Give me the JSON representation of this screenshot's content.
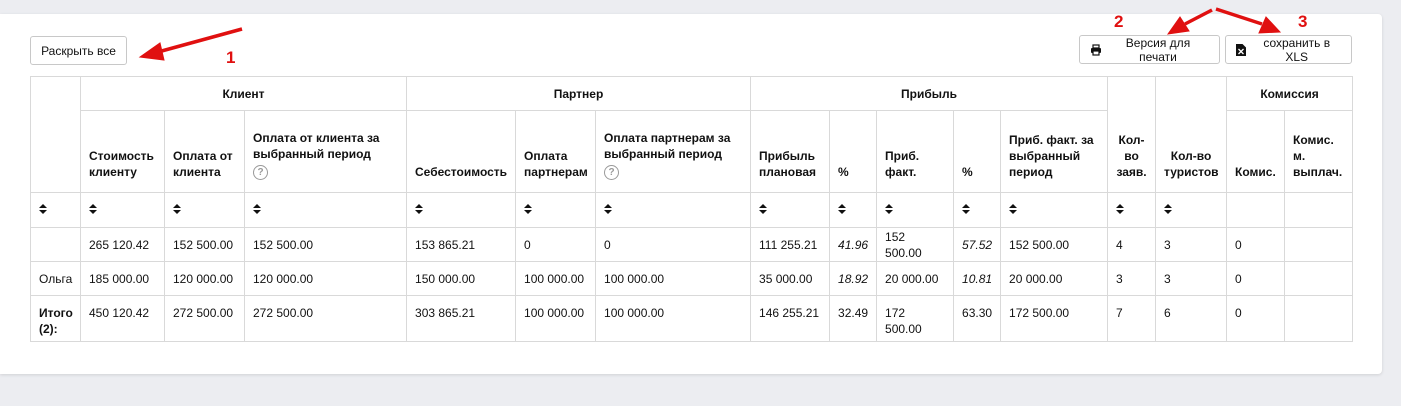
{
  "toolbar": {
    "expand_label": "Раскрыть все",
    "print_label": "Версия для печати",
    "xls_label": "сохранить в XLS"
  },
  "annotations": {
    "label_1": "1",
    "label_2": "2",
    "label_3": "3",
    "color": "#e01010"
  },
  "table": {
    "groups": {
      "client": "Клиент",
      "partner": "Партнер",
      "profit": "Прибыль",
      "commission": "Комиссия"
    },
    "columns": {
      "cost_client": "Стоимость клиенту",
      "paid_client": "Оплата от клиента",
      "paid_client_period": "Оплата от клиента за выбранный период",
      "cost_price": "Себестоимость",
      "paid_partner": "Оплата партнерам",
      "paid_partner_period": "Оплата партнерам за выбранный период",
      "profit_plan": "Прибыль плановая",
      "pct1": "%",
      "profit_fact": "Приб. факт.",
      "pct2": "%",
      "profit_fact_period": "Приб. факт. за выбранный период",
      "orders": "Кол-во заяв.",
      "tourists": "Кол-во туристов",
      "commission": "Комис.",
      "commission_paid": "Комис. м. выплач."
    },
    "rows": [
      {
        "name": "",
        "cost_client": "265 120.42",
        "paid_client": "152 500.00",
        "paid_client_period": "152 500.00",
        "cost_price": "153 865.21",
        "paid_partner": "0",
        "paid_partner_period": "0",
        "profit_plan": "111 255.21",
        "pct1": "41.96",
        "profit_fact": "152 500.00",
        "pct2": "57.52",
        "profit_fact_period": "152 500.00",
        "orders": "4",
        "tourists": "3",
        "commission": "0",
        "commission_paid": ""
      },
      {
        "name": "Ольга",
        "cost_client": "185 000.00",
        "paid_client": "120 000.00",
        "paid_client_period": "120 000.00",
        "cost_price": "150 000.00",
        "paid_partner": "100 000.00",
        "paid_partner_period": "100 000.00",
        "profit_plan": "35 000.00",
        "pct1": "18.92",
        "profit_fact": "20 000.00",
        "pct2": "10.81",
        "profit_fact_period": "20 000.00",
        "orders": "3",
        "tourists": "3",
        "commission": "0",
        "commission_paid": ""
      },
      {
        "name": "Итого (2):",
        "cost_client": "450 120.42",
        "paid_client": "272 500.00",
        "paid_client_period": "272 500.00",
        "cost_price": "303 865.21",
        "paid_partner": "100 000.00",
        "paid_partner_period": "100 000.00",
        "profit_plan": "146 255.21",
        "pct1": "32.49",
        "profit_fact": "172 500.00",
        "pct2": "63.30",
        "profit_fact_period": "172 500.00",
        "orders": "7",
        "tourists": "6",
        "commission": "0",
        "commission_paid": ""
      }
    ]
  }
}
